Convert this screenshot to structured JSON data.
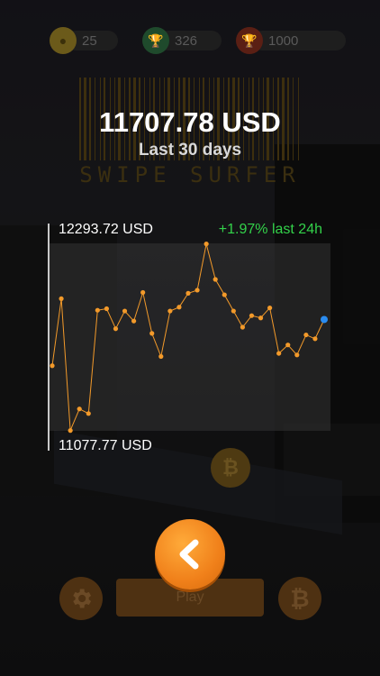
{
  "stats": {
    "coins": "25",
    "trophies": "326",
    "best": "1000"
  },
  "logo": {
    "text": "SWIPE SURFER"
  },
  "price": {
    "current": "11707.78 USD",
    "period": "Last 30 days",
    "high": "12293.72 USD",
    "low": "11077.77 USD",
    "change": "+1.97% last 24h"
  },
  "chart_data": {
    "type": "line",
    "x": [
      1,
      2,
      3,
      4,
      5,
      6,
      7,
      8,
      9,
      10,
      11,
      12,
      13,
      14,
      15,
      16,
      17,
      18,
      19,
      20,
      21,
      22,
      23,
      24,
      25,
      26,
      27,
      28,
      29,
      30,
      31
    ],
    "values": [
      11500,
      11935,
      11080,
      11220,
      11190,
      11860,
      11870,
      11740,
      11855,
      11790,
      11975,
      11710,
      11560,
      11855,
      11880,
      11970,
      11990,
      12290,
      12060,
      11960,
      11855,
      11750,
      11825,
      11810,
      11875,
      11580,
      11635,
      11570,
      11700,
      11675,
      11800
    ],
    "last_point_color": "#2b8cf0",
    "line_color": "#f39a2a",
    "ylim": [
      11077.77,
      12293.72
    ]
  },
  "buttons": {
    "back_icon": "chevron-left-icon",
    "play_label": "Play",
    "settings_icon": "gear-icon",
    "bitcoin_icon": "bitcoin-icon",
    "bitcoin_symbol": "₿"
  },
  "colors": {
    "accent": "#f0801a",
    "positive": "#33d24a"
  }
}
